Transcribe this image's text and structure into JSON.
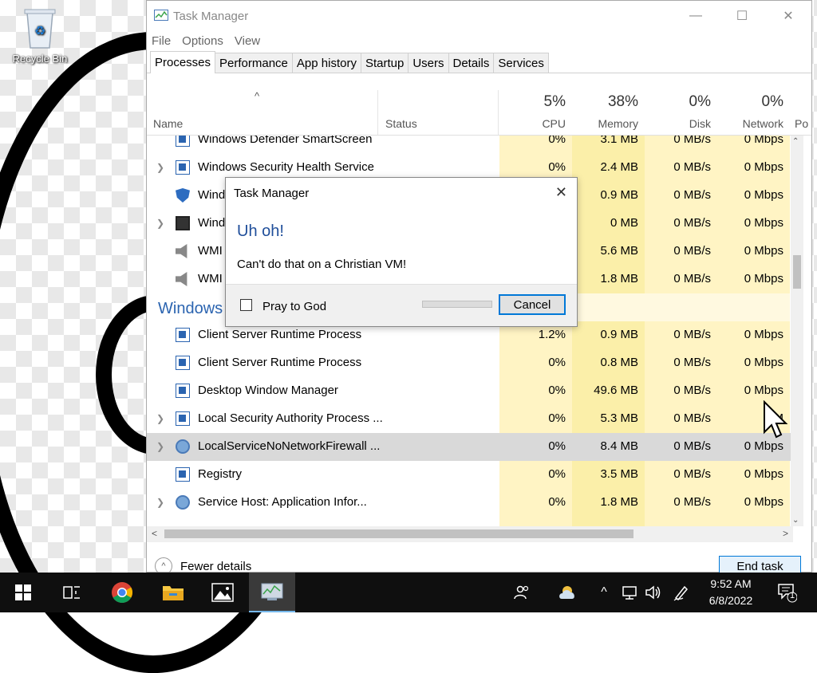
{
  "desktop": {
    "recycle_bin_label": "Recycle Bin"
  },
  "window": {
    "title": "Task Manager",
    "controls": {
      "minimize": "—",
      "maximize": "☐",
      "close": "✕"
    },
    "menu": [
      "File",
      "Options",
      "View"
    ],
    "tabs": [
      "Processes",
      "Performance",
      "App history",
      "Startup",
      "Users",
      "Details",
      "Services"
    ],
    "active_tab": "Processes"
  },
  "columns": {
    "name": "Name",
    "status": "Status",
    "cpu": {
      "label": "CPU",
      "total": "5%"
    },
    "memory": {
      "label": "Memory",
      "total": "38%"
    },
    "disk": {
      "label": "Disk",
      "total": "0%"
    },
    "network": {
      "label": "Network",
      "total": "0%"
    },
    "power": {
      "label": "Po"
    }
  },
  "rows": [
    {
      "name": "Windows Defender SmartScreen",
      "cpu": "0%",
      "memory": "3.1 MB",
      "disk": "0 MB/s",
      "network": "0 Mbps",
      "expand": false,
      "icon": "process-icon"
    },
    {
      "name": "Windows Security Health Service",
      "cpu": "0%",
      "memory": "2.4 MB",
      "disk": "0 MB/s",
      "network": "0 Mbps",
      "expand": true,
      "icon": "process-icon"
    },
    {
      "name": "Wind",
      "cpu": "",
      "memory": "0.9 MB",
      "disk": "0 MB/s",
      "network": "0 Mbps",
      "expand": false,
      "icon": "shield-icon"
    },
    {
      "name": "Wind",
      "cpu": "",
      "memory": "0 MB",
      "disk": "0 MB/s",
      "network": "0 Mbps",
      "expand": true,
      "icon": "window-icon"
    },
    {
      "name": "WMI",
      "cpu": "",
      "memory": "5.6 MB",
      "disk": "0 MB/s",
      "network": "0 Mbps",
      "expand": false,
      "icon": "wmi-icon"
    },
    {
      "name": "WMI",
      "cpu": "",
      "memory": "1.8 MB",
      "disk": "0 MB/s",
      "network": "0 Mbps",
      "expand": false,
      "icon": "wmi-icon"
    },
    {
      "group": "Windows"
    },
    {
      "name": "Client Server Runtime Process",
      "cpu": "1.2%",
      "memory": "0.9 MB",
      "disk": "0 MB/s",
      "network": "0 Mbps",
      "expand": false,
      "icon": "process-icon"
    },
    {
      "name": "Client Server Runtime Process",
      "cpu": "0%",
      "memory": "0.8 MB",
      "disk": "0 MB/s",
      "network": "0 Mbps",
      "expand": false,
      "icon": "process-icon"
    },
    {
      "name": "Desktop Window Manager",
      "cpu": "0%",
      "memory": "49.6 MB",
      "disk": "0 MB/s",
      "network": "0 Mbps",
      "expand": false,
      "icon": "process-icon"
    },
    {
      "name": "Local Security Authority Process ...",
      "cpu": "0%",
      "memory": "5.3 MB",
      "disk": "0 MB/s",
      "network": "0 M",
      "expand": true,
      "icon": "process-icon"
    },
    {
      "name": "LocalServiceNoNetworkFirewall ...",
      "cpu": "0%",
      "memory": "8.4 MB",
      "disk": "0 MB/s",
      "network": "0 Mbps",
      "expand": true,
      "icon": "gear-icon",
      "selected": true
    },
    {
      "name": "Registry",
      "cpu": "0%",
      "memory": "3.5 MB",
      "disk": "0 MB/s",
      "network": "0 Mbps",
      "expand": false,
      "icon": "process-icon"
    },
    {
      "name": "Service Host: Application Infor...",
      "cpu": "0%",
      "memory": "1.8 MB",
      "disk": "0 MB/s",
      "network": "0 Mbps",
      "expand": true,
      "icon": "gear-icon"
    }
  ],
  "footer": {
    "fewer_details": "Fewer details",
    "end_task": "End task"
  },
  "dialog": {
    "title": "Task Manager",
    "heading": "Uh oh!",
    "message": "Can't do that on a Christian VM!",
    "checkbox_label": "Pray to God",
    "cancel_label": "Cancel"
  },
  "taskbar": {
    "time": "9:52 AM",
    "date": "6/8/2022",
    "notification_count": "1"
  },
  "colors": {
    "accent": "#0078d7",
    "heat_light": "#fff4c4",
    "heat_medium": "#fbefa9",
    "group_blue": "#2b64b0"
  }
}
